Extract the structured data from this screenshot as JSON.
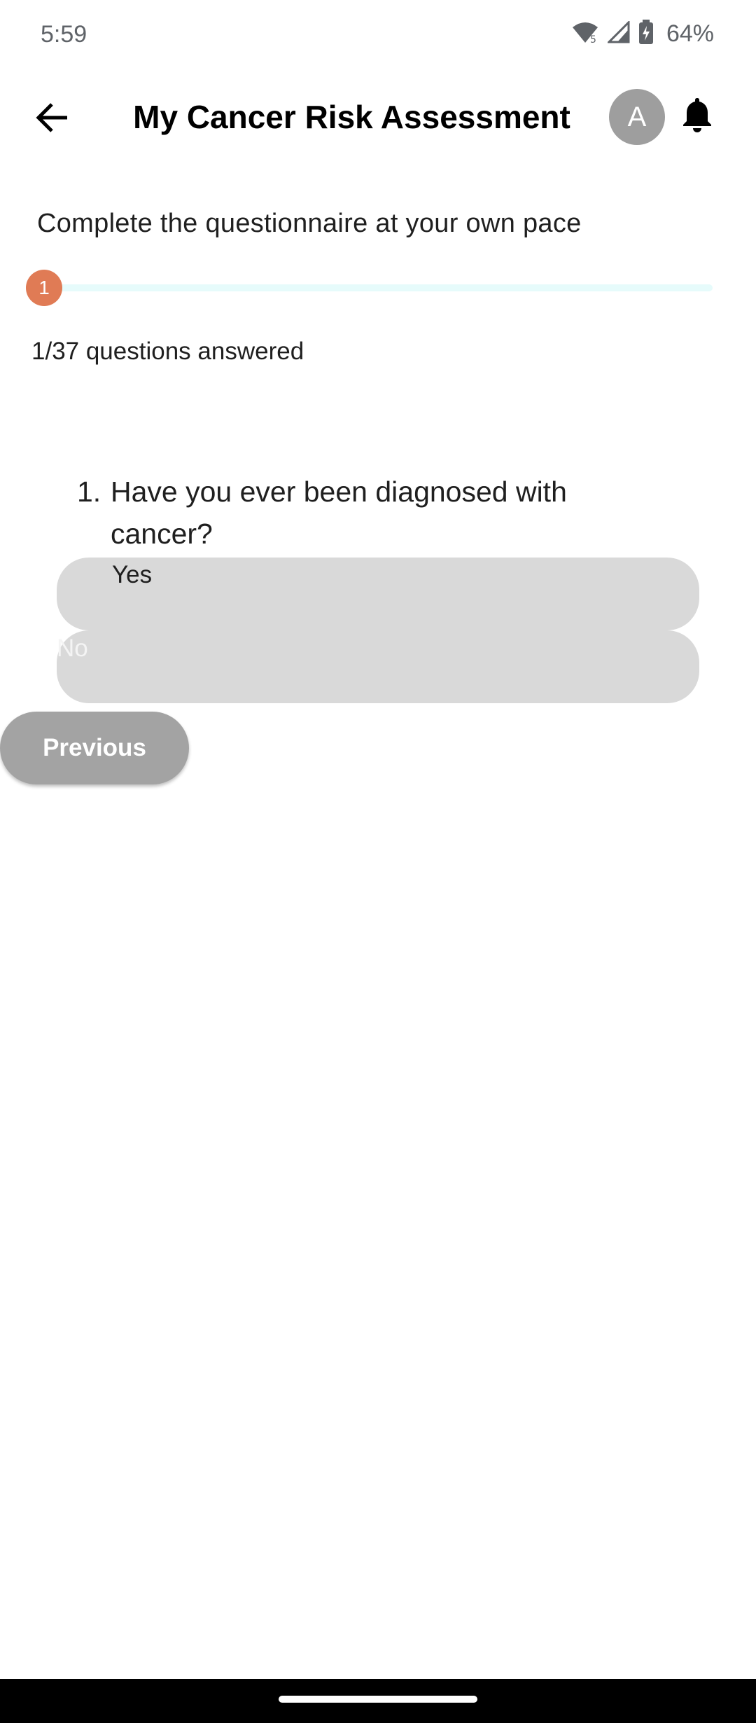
{
  "status_bar": {
    "time": "5:59",
    "battery_percent": "64%"
  },
  "header": {
    "title": "My Cancer Risk Assessment",
    "avatar_letter": "A"
  },
  "questionnaire": {
    "subtitle": "Complete the questionnaire at your own pace",
    "progress_step": "1",
    "progress_fraction": 0.027,
    "answered_text": "1/37 questions answered",
    "question": {
      "number": "1.",
      "text": "Have you ever been diagnosed with cancer?",
      "options": [
        "Yes",
        "No"
      ]
    }
  },
  "navigation": {
    "previous_label": "Previous"
  },
  "colors": {
    "accent_marker": "#e07b55",
    "option_bg": "#d9d9d9",
    "button_bg": "#a3a3a3"
  }
}
